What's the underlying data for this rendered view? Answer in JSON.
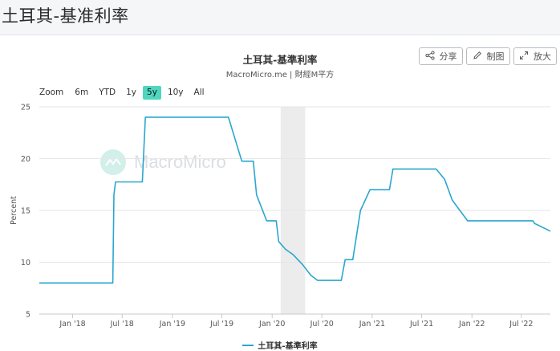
{
  "page": {
    "title": "土耳其-基准利率"
  },
  "toolbar": {
    "share_label": "分享",
    "draw_label": "制图",
    "expand_label": "放大"
  },
  "zoom": {
    "label": "Zoom",
    "options": [
      "6m",
      "YTD",
      "1y",
      "5y",
      "10y",
      "All"
    ],
    "active": "5y"
  },
  "watermark": {
    "text": "MacroMicro"
  },
  "colors": {
    "series": "#2aa6cf",
    "recession_band": "#ececec",
    "zoom_active": "#4fd6bf"
  },
  "chart_data": {
    "type": "line",
    "title": "土耳其-基準利率",
    "subtitle": "MacroMicro.me | 財經M平方",
    "ylabel": "Percent",
    "ylim": [
      5,
      25
    ],
    "yticks": [
      5,
      10,
      15,
      20,
      25
    ],
    "xlim": [
      "2017-09-01",
      "2022-10-15"
    ],
    "xticks": [
      {
        "date": "2018-01-01",
        "label": "Jan '18"
      },
      {
        "date": "2018-07-01",
        "label": "Jul '18"
      },
      {
        "date": "2019-01-01",
        "label": "Jan '19"
      },
      {
        "date": "2019-07-01",
        "label": "Jul '19"
      },
      {
        "date": "2020-01-01",
        "label": "Jan '20"
      },
      {
        "date": "2020-07-01",
        "label": "Jul '20"
      },
      {
        "date": "2021-01-01",
        "label": "Jan '21"
      },
      {
        "date": "2021-07-01",
        "label": "Jul '21"
      },
      {
        "date": "2022-01-01",
        "label": "Jan '22"
      },
      {
        "date": "2022-07-01",
        "label": "Jul '22"
      }
    ],
    "shaded_band": {
      "start": "2020-02-01",
      "end": "2020-05-01"
    },
    "grid": true,
    "legend": "bottom-center",
    "series": [
      {
        "name": "土耳其-基準利率",
        "points": [
          {
            "x": "2017-09-01",
            "y": 8.0
          },
          {
            "x": "2018-05-28",
            "y": 8.0
          },
          {
            "x": "2018-06-01",
            "y": 16.5
          },
          {
            "x": "2018-06-07",
            "y": 17.75
          },
          {
            "x": "2018-09-13",
            "y": 17.75
          },
          {
            "x": "2018-09-24",
            "y": 24.0
          },
          {
            "x": "2019-07-25",
            "y": 24.0
          },
          {
            "x": "2019-09-12",
            "y": 19.75
          },
          {
            "x": "2019-10-24",
            "y": 19.75
          },
          {
            "x": "2019-11-05",
            "y": 16.5
          },
          {
            "x": "2019-12-12",
            "y": 14.0
          },
          {
            "x": "2020-01-16",
            "y": 14.0
          },
          {
            "x": "2020-01-25",
            "y": 12.0
          },
          {
            "x": "2020-02-19",
            "y": 11.25
          },
          {
            "x": "2020-03-17",
            "y": 10.75
          },
          {
            "x": "2020-04-22",
            "y": 9.75
          },
          {
            "x": "2020-05-21",
            "y": 8.75
          },
          {
            "x": "2020-06-15",
            "y": 8.25
          },
          {
            "x": "2020-09-10",
            "y": 8.25
          },
          {
            "x": "2020-09-24",
            "y": 10.25
          },
          {
            "x": "2020-10-22",
            "y": 10.25
          },
          {
            "x": "2020-11-19",
            "y": 15.0
          },
          {
            "x": "2020-12-24",
            "y": 17.0
          },
          {
            "x": "2021-03-05",
            "y": 17.0
          },
          {
            "x": "2021-03-18",
            "y": 19.0
          },
          {
            "x": "2021-08-23",
            "y": 19.0
          },
          {
            "x": "2021-09-23",
            "y": 18.0
          },
          {
            "x": "2021-10-21",
            "y": 16.0
          },
          {
            "x": "2021-11-18",
            "y": 15.0
          },
          {
            "x": "2021-12-16",
            "y": 14.0
          },
          {
            "x": "2022-08-12",
            "y": 14.0
          },
          {
            "x": "2022-08-18",
            "y": 13.75
          },
          {
            "x": "2022-10-15",
            "y": 13.0
          }
        ]
      }
    ]
  }
}
